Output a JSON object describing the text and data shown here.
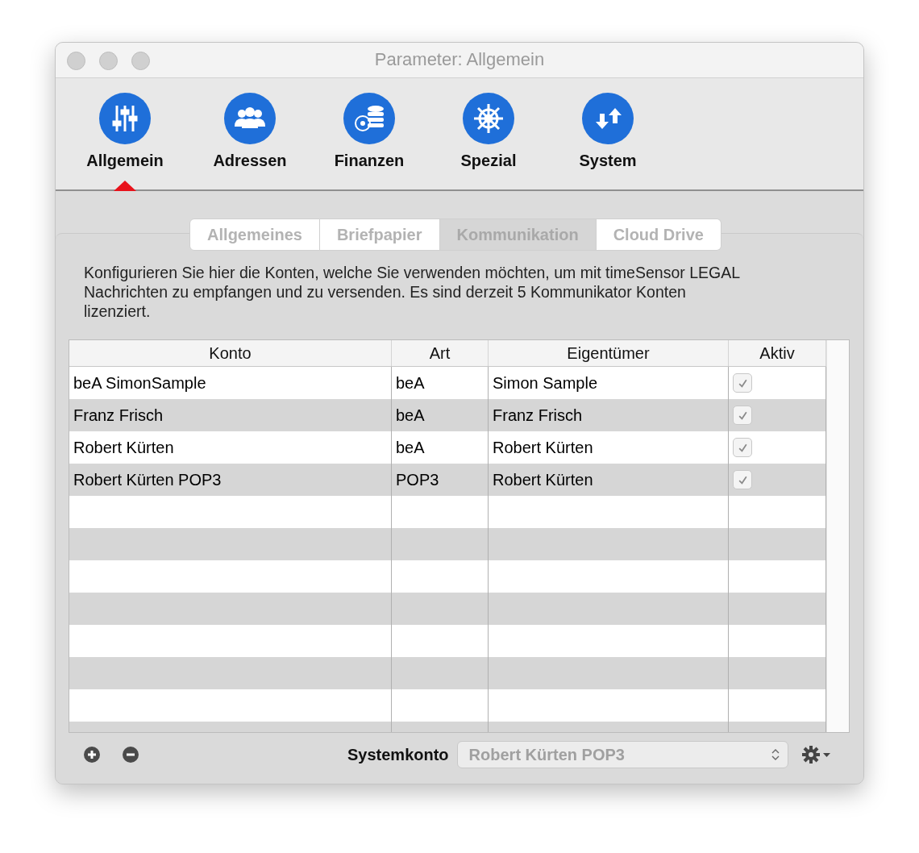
{
  "window": {
    "title": "Parameter: Allgemein"
  },
  "toolbar": [
    {
      "label": "Allgemein",
      "kind": "sliders",
      "selected": true
    },
    {
      "label": "Adressen",
      "kind": "people",
      "selected": false
    },
    {
      "label": "Finanzen",
      "kind": "coins",
      "selected": false
    },
    {
      "label": "Spezial",
      "kind": "wheel",
      "selected": false
    },
    {
      "label": "System",
      "kind": "arrows",
      "selected": false
    }
  ],
  "tabs": [
    {
      "label": "Allgemeines",
      "selected": false
    },
    {
      "label": "Briefpapier",
      "selected": false
    },
    {
      "label": "Kommunikation",
      "selected": true
    },
    {
      "label": "Cloud Drive",
      "selected": false
    }
  ],
  "description": "Konfigurieren Sie hier die Konten, welche Sie verwenden möchten, um mit timeSensor LEGAL Nachrichten zu empfangen und zu versenden. Es sind derzeit 5 Kommunikator Konten lizenziert.",
  "table": {
    "columns": [
      "Konto",
      "Art",
      "Eigentümer",
      "Aktiv"
    ],
    "rows": [
      {
        "konto": "beA SimonSample",
        "art": "beA",
        "eigentuemer": "Simon Sample",
        "aktiv": true
      },
      {
        "konto": "Franz Frisch",
        "art": "beA",
        "eigentuemer": "Franz Frisch",
        "aktiv": true
      },
      {
        "konto": "Robert Kürten",
        "art": "beA",
        "eigentuemer": "Robert Kürten",
        "aktiv": true
      },
      {
        "konto": "Robert Kürten POP3",
        "art": "POP3",
        "eigentuemer": "Robert Kürten",
        "aktiv": true
      }
    ]
  },
  "systemkonto": {
    "label": "Systemkonto",
    "value": "Robert Kürten POP3"
  }
}
